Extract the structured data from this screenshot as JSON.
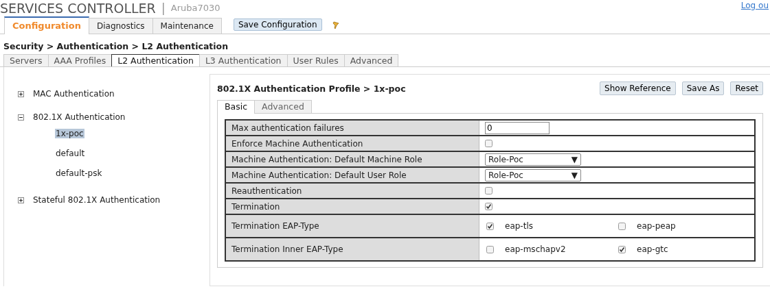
{
  "header": {
    "title": "SERVICES CONTROLLER",
    "separator": "|",
    "device": "Aruba7030",
    "logout": "Log ou"
  },
  "main_tabs": [
    {
      "label": "Configuration",
      "selected": true
    },
    {
      "label": "Diagnostics",
      "selected": false
    },
    {
      "label": "Maintenance",
      "selected": false
    }
  ],
  "save_button": "Save Configuration",
  "breadcrumb": "Security > Authentication > L2 Authentication",
  "sub_tabs": [
    {
      "label": "Servers",
      "selected": false
    },
    {
      "label": "AAA Profiles",
      "selected": false
    },
    {
      "label": "L2 Authentication",
      "selected": true
    },
    {
      "label": "L3 Authentication",
      "selected": false
    },
    {
      "label": "User Rules",
      "selected": false
    },
    {
      "label": "Advanced",
      "selected": false
    }
  ],
  "tree": [
    {
      "label": "MAC Authentication",
      "expanded": false
    },
    {
      "label": "802.1X Authentication",
      "expanded": true,
      "children": [
        {
          "label": "1x-poc",
          "selected": true
        },
        {
          "label": "default",
          "selected": false
        },
        {
          "label": "default-psk",
          "selected": false
        }
      ]
    },
    {
      "label": "Stateful 802.1X Authentication",
      "expanded": false
    }
  ],
  "profile": {
    "title": "802.1X Authentication Profile > 1x-poc",
    "buttons": [
      "Show Reference",
      "Save As",
      "Reset"
    ],
    "tabs": [
      {
        "label": "Basic",
        "selected": true
      },
      {
        "label": "Advanced",
        "selected": false
      }
    ],
    "rows": [
      {
        "label": "Max authentication failures",
        "kind": "text",
        "value": "0"
      },
      {
        "label": "Enforce Machine Authentication",
        "kind": "checkbox",
        "checked": false
      },
      {
        "label": "Machine Authentication: Default Machine Role",
        "kind": "select",
        "value": "Role-Poc",
        "arrow": "▼"
      },
      {
        "label": "Machine Authentication: Default User Role",
        "kind": "select",
        "value": "Role-Poc",
        "arrow": "▼"
      },
      {
        "label": "Reauthentication",
        "kind": "checkbox",
        "checked": false
      },
      {
        "label": "Termination",
        "kind": "checkbox",
        "checked": true
      },
      {
        "label": "Termination EAP-Type",
        "kind": "multi",
        "options": [
          {
            "label": "eap-tls",
            "checked": true
          },
          {
            "label": "eap-peap",
            "checked": false
          }
        ]
      },
      {
        "label": "Termination Inner EAP-Type",
        "kind": "multi",
        "options": [
          {
            "label": "eap-mschapv2",
            "checked": false
          },
          {
            "label": "eap-gtc",
            "checked": true
          }
        ]
      }
    ]
  }
}
